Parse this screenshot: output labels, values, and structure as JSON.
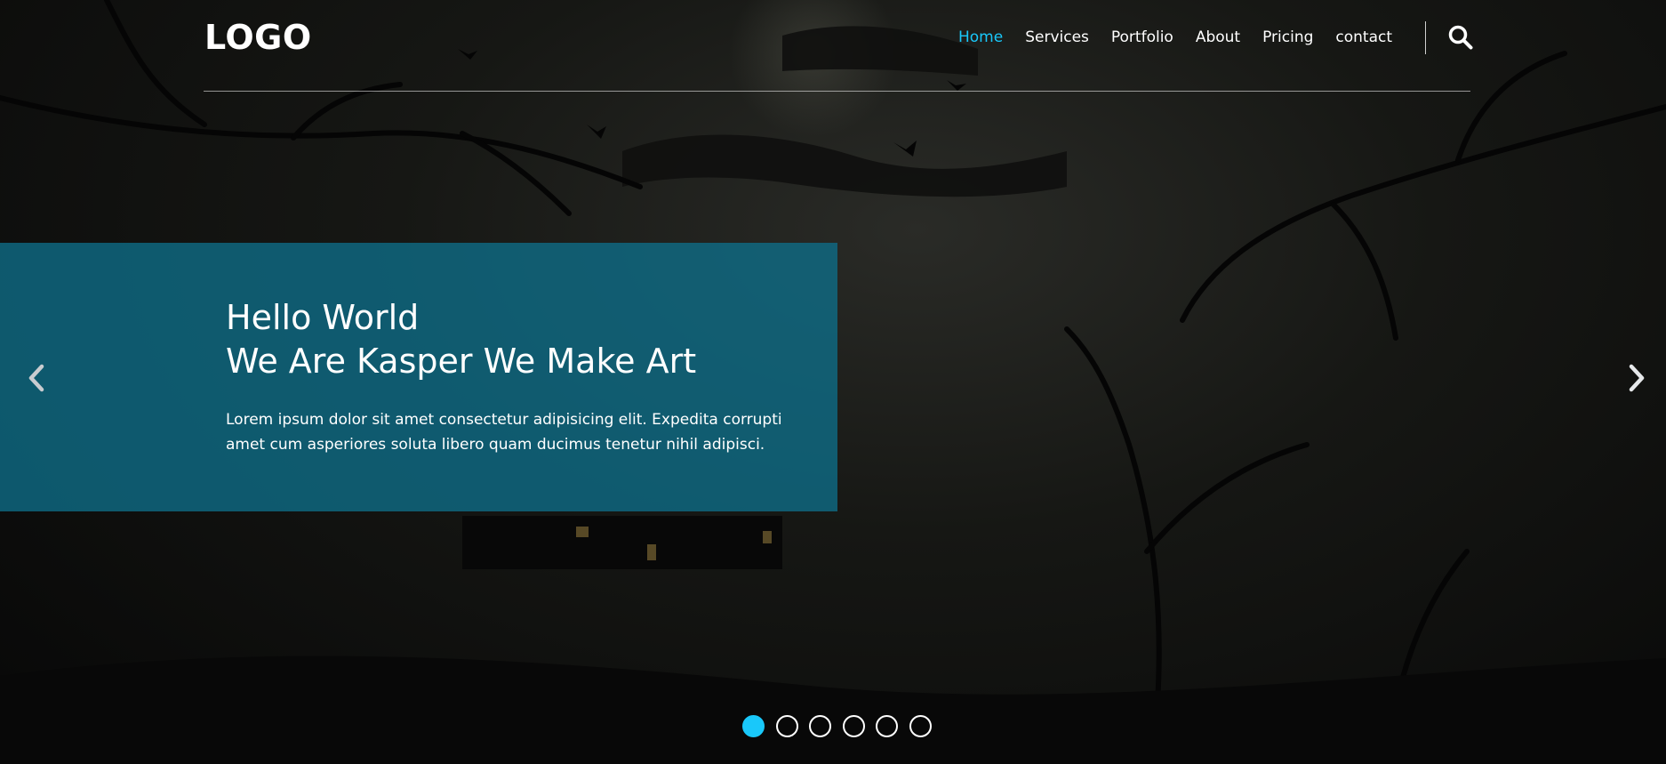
{
  "brand": {
    "logo": "LOGO"
  },
  "nav": {
    "items": [
      {
        "label": "Home",
        "active": true
      },
      {
        "label": "Services",
        "active": false
      },
      {
        "label": "Portfolio",
        "active": false
      },
      {
        "label": "About",
        "active": false
      },
      {
        "label": "Pricing",
        "active": false
      },
      {
        "label": "contact",
        "active": false
      }
    ],
    "search_icon": "search-icon"
  },
  "hero": {
    "title_line1": "Hello World",
    "title_line2": "We Are Kasper We Make Art",
    "text": "Lorem ipsum dolor sit amet consectetur adipisicing elit. Expedita corrupti amet cum asperiores soluta libero quam ducimus tenetur nihil adipisci."
  },
  "slider": {
    "prev_icon": "chevron-left-icon",
    "next_icon": "chevron-right-icon",
    "bullet_count": 6,
    "active_bullet": 0
  },
  "colors": {
    "accent": "#19c8fa",
    "hero_box": "#0e6e89"
  }
}
